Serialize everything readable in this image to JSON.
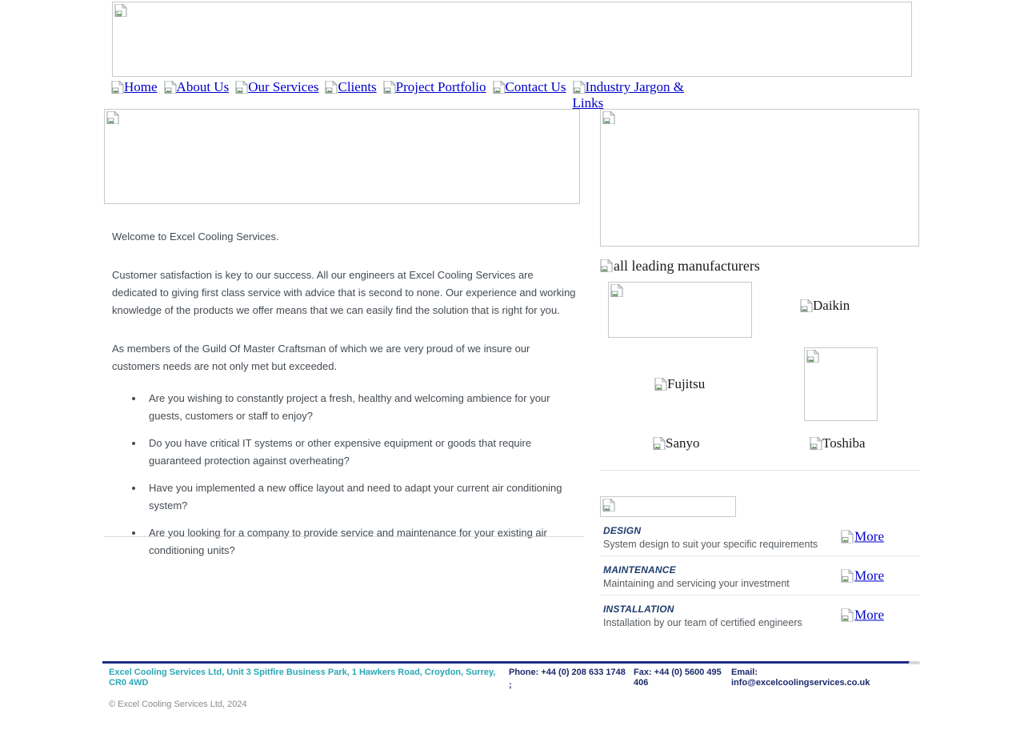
{
  "site": {
    "title": "Excel Cooling Services",
    "banner_alt": "",
    "hero_alt": "",
    "right_image_alt": ""
  },
  "nav": {
    "items": [
      {
        "label": "Home",
        "icon": "broken-image-icon"
      },
      {
        "label": "About Us",
        "icon": "broken-image-icon"
      },
      {
        "label": "Our Services",
        "icon": "broken-image-icon"
      },
      {
        "label": "Clients",
        "icon": "broken-image-icon"
      },
      {
        "label": "Project Portfolio",
        "icon": "broken-image-icon"
      },
      {
        "label": "Contact Us",
        "icon": "broken-image-icon"
      },
      {
        "label": "Industry Jargon & Links",
        "icon": "broken-image-icon"
      }
    ]
  },
  "main": {
    "welcome": "Welcome to Excel Cooling Services.",
    "paragraph_1": "Customer satisfaction is key to our success. All our engineers at Excel Cooling Services are dedicated to giving first class service with advice that is second to none. Our experience and working knowledge of the products we offer means that we can easily find the solution that is right for you.",
    "paragraph_2": "As members of the Guild Of Master Craftsman of which we are very proud of we insure our customers needs are not only met but exceeded.",
    "bullets": [
      "Are you wishing to constantly project a fresh, healthy and welcoming ambience for your guests, customers or staff to enjoy?",
      "Do you have critical IT systems or other expensive equipment or goods that require guaranteed protection against overheating?",
      "Have you implemented a new office layout and need to adapt your current air conditioning system?",
      "Are you looking for a company to provide service and maintenance for your existing air conditioning units?"
    ]
  },
  "manufacturers": {
    "heading_alt": "all leading manufacturers",
    "logos": [
      {
        "alt": "",
        "boxed": true
      },
      {
        "alt": "Daikin",
        "boxed": false
      },
      {
        "alt": "Fujitsu",
        "boxed": false
      },
      {
        "alt": "",
        "boxed": true
      },
      {
        "alt": "Sanyo",
        "boxed": false
      },
      {
        "alt": "Toshiba",
        "boxed": false
      }
    ]
  },
  "services": {
    "banner_alt": "",
    "more_label": "More",
    "rows": [
      {
        "title": "DESIGN",
        "desc": "System design to suit your specific requirements",
        "more": "More"
      },
      {
        "title": "MAINTENANCE",
        "desc": "Maintaining and servicing your investment",
        "more": "More"
      },
      {
        "title": "INSTALLATION",
        "desc": "Installation by our team of certified engineers",
        "more": "More"
      }
    ]
  },
  "footer": {
    "address": "Excel Cooling Services Ltd, Unit 3 Spitfire Business Park, 1 Hawkers Road, Croydon, Surrey, CR0 4WD",
    "copyright": "© Excel Cooling Services Ltd, 2024",
    "phone": "Phone: +44 (0) 208 633 1748",
    "phone_extra": ";",
    "fax": "Fax: +44 (0) 5600 495 406",
    "email_label": "Email:",
    "email": "info@excelcoolingservices.co.uk"
  },
  "colors": {
    "link": "#0000cc",
    "footer_bar": "#1f2d86",
    "address_teal": "#2aa8b5",
    "footer_navy": "#1b2a6b",
    "service_title": "#1f3d6e",
    "body_text": "#444b52"
  }
}
